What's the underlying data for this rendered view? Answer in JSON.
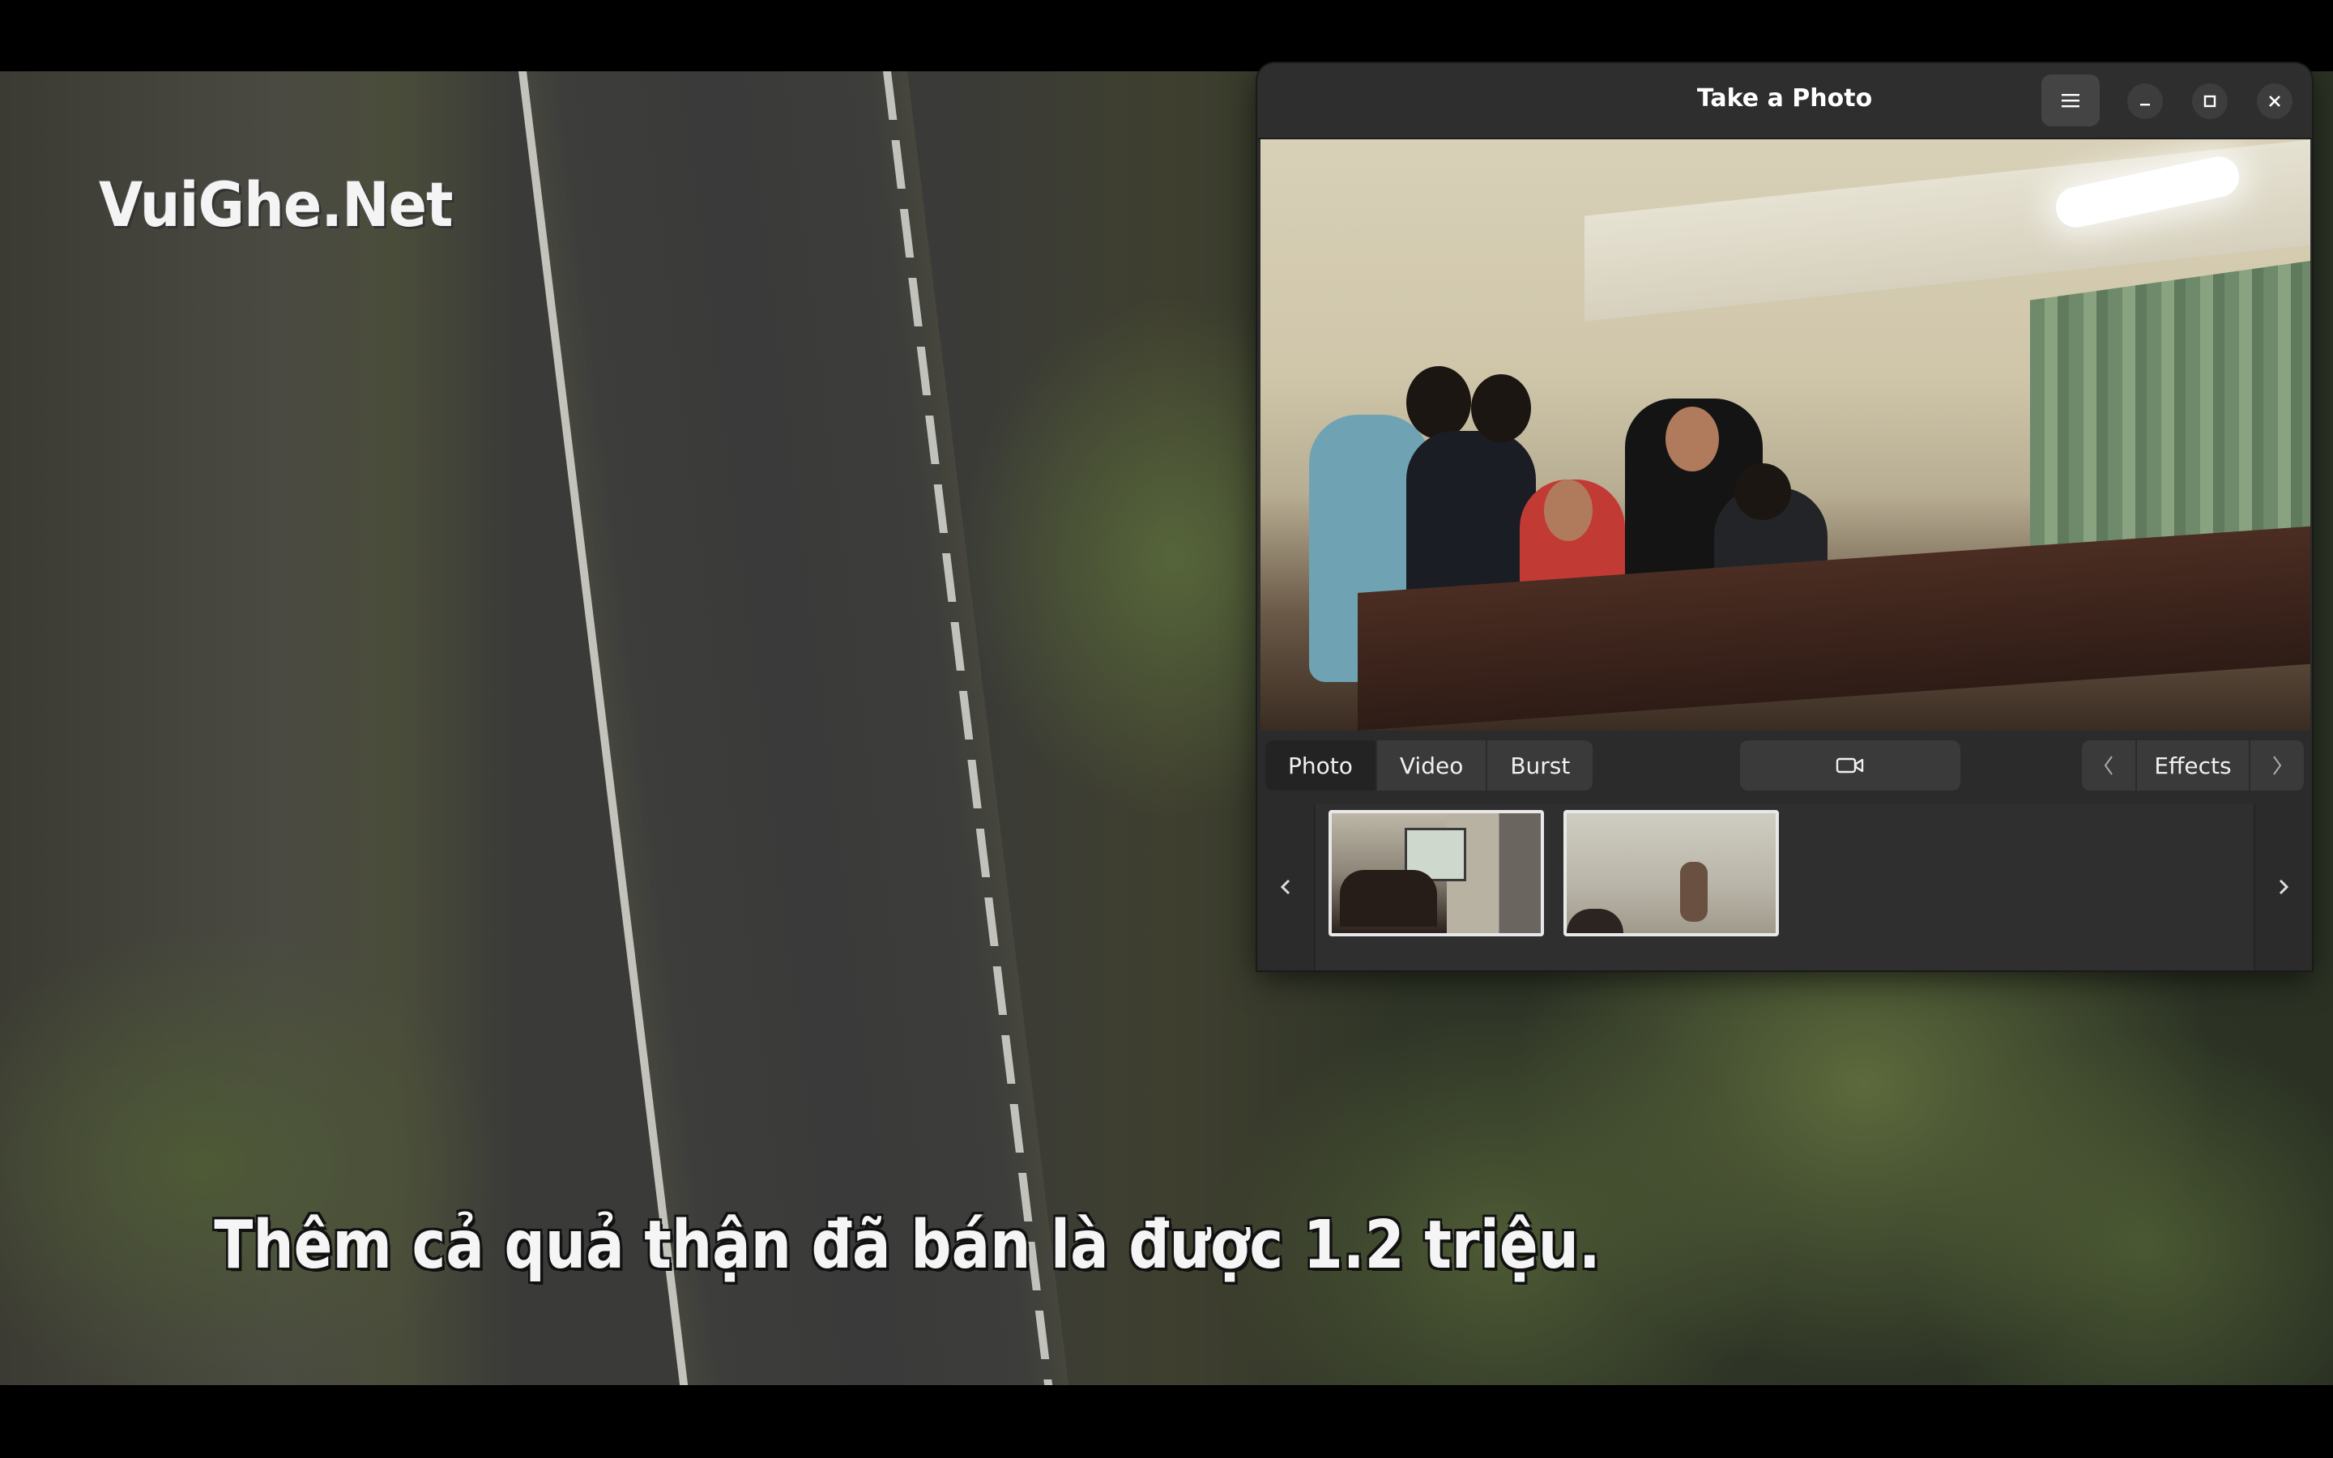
{
  "background_video": {
    "watermark": "VuiGhe.Net",
    "subtitle": "Thêm cả quả thận đã bán là được 1.2 triệu."
  },
  "window": {
    "title": "Take a Photo",
    "menu_icon": "hamburger-menu-icon",
    "controls": [
      "minimize-icon",
      "maximize-icon",
      "close-icon"
    ]
  },
  "capture": {
    "modes": [
      {
        "label": "Photo",
        "active": true
      },
      {
        "label": "Video",
        "active": false
      },
      {
        "label": "Burst",
        "active": false
      }
    ],
    "shutter_icon": "video-camera-icon",
    "effects": {
      "label": "Effects",
      "prev_icon": "chevron-left-icon",
      "next_icon": "chevron-right-icon"
    }
  },
  "gallery": {
    "thumbnails": [
      "photo-thumbnail-1",
      "photo-thumbnail-2"
    ],
    "prev_icon": "chevron-left-icon",
    "next_icon": "chevron-right-icon"
  },
  "colors": {
    "window_bg": "#2b2b2b",
    "titlebar_bg": "#2e2e2e",
    "button_bg": "#3a3a3a",
    "active_mode_bg": "#232323",
    "text": "#f0f0f0"
  }
}
